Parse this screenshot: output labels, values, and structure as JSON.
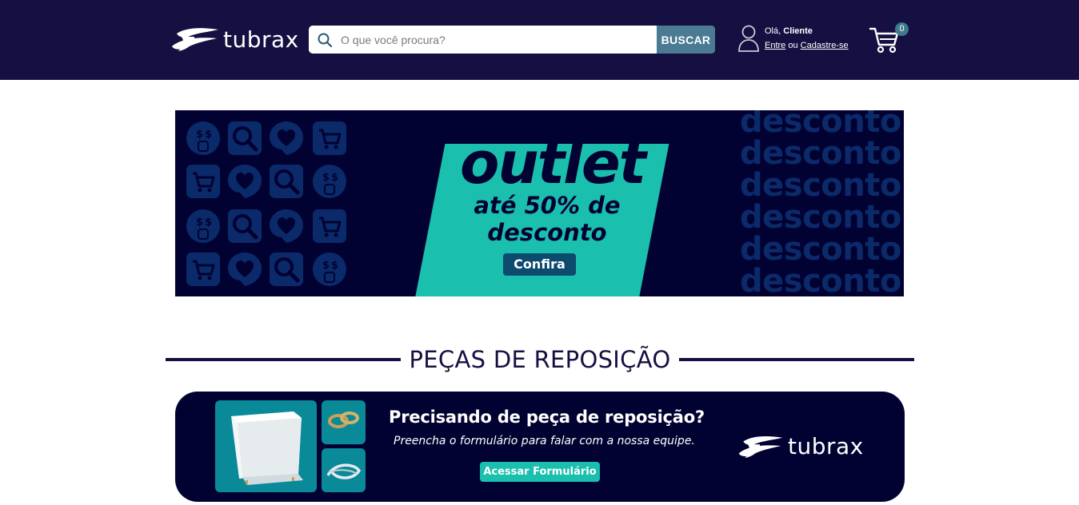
{
  "header": {
    "brand": "tubrax",
    "search": {
      "placeholder": "O que você procura?",
      "button_label": "BUSCAR"
    },
    "account": {
      "greeting": "Olá,",
      "name": "Cliente",
      "login_label": "Entre",
      "separator": "ou",
      "register_label": "Cadastre-se"
    },
    "cart": {
      "count": "0"
    }
  },
  "promo_banner": {
    "title": "outlet",
    "subtitle_line1": "até 50% de",
    "subtitle_line2": "desconto",
    "button_label": "Confira",
    "background_words": [
      "desconto",
      "desconto",
      "desconto",
      "desconto",
      "desconto",
      "desconto"
    ],
    "tile_icons": [
      "money-face-icon",
      "magnifier-icon",
      "heart-icon",
      "cart-icon"
    ]
  },
  "section": {
    "title": "PEÇAS DE REPOSIÇÃO"
  },
  "parts_banner": {
    "title": "Precisando de peça de reposição?",
    "subtitle": "Preencha o formulário para falar com a nossa equipe.",
    "button_label": "Acessar Formulário",
    "brand": "tubrax"
  },
  "colors": {
    "header_bg": "#161042",
    "banner_bg": "#020232",
    "accent_teal": "#1abfae",
    "search_button": "#4a7b93"
  }
}
